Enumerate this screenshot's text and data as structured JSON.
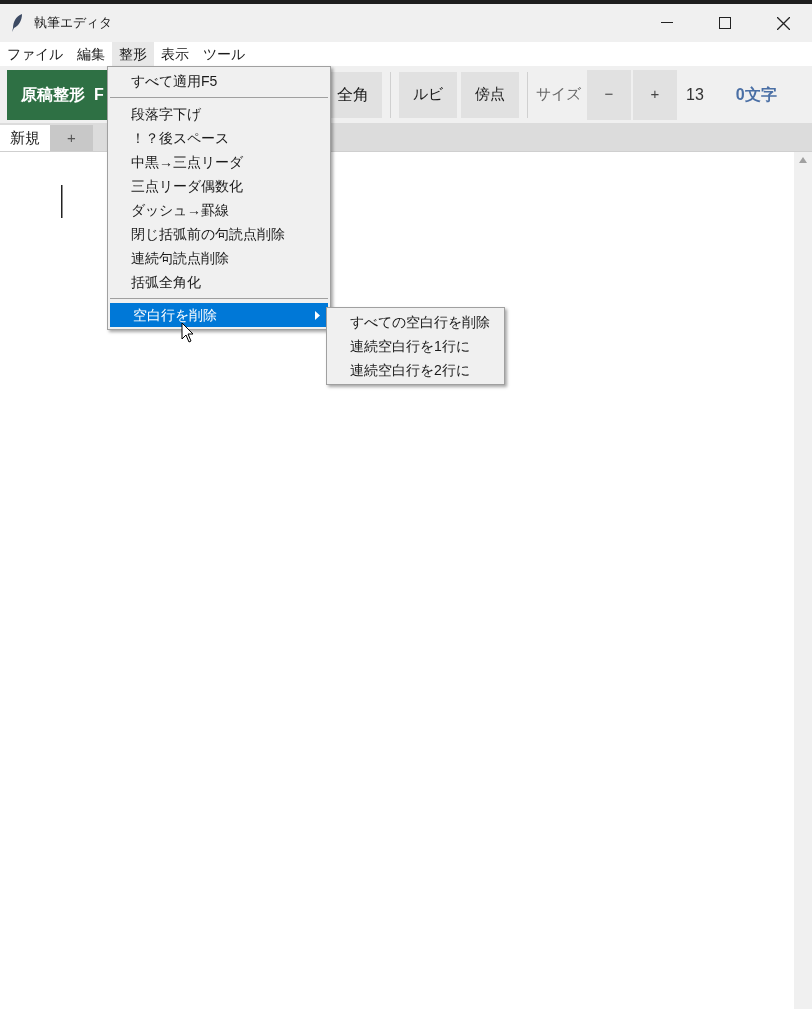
{
  "window": {
    "title": "執筆エディタ"
  },
  "menubar": [
    {
      "label": "ファイル",
      "selected": false
    },
    {
      "label": "編集",
      "selected": false
    },
    {
      "label": "整形",
      "selected": true
    },
    {
      "label": "表示",
      "selected": false
    },
    {
      "label": "ツール",
      "selected": false
    }
  ],
  "toolbar": {
    "format_button": "原稿整形  F",
    "bracket_button": "全角",
    "ruby_button": "ルビ",
    "emphasis_button": "傍点",
    "size_label": "サイズ",
    "decrease": "−",
    "increase": "+",
    "size_value": "13",
    "char_count": "0文字"
  },
  "tabs": [
    {
      "label": "新規",
      "selected": true
    },
    {
      "label": "+",
      "selected": false
    }
  ],
  "menu": {
    "items": [
      {
        "kind": "item",
        "label": "すべて適用F5",
        "selected": false
      },
      {
        "kind": "separator"
      },
      {
        "kind": "item",
        "label": "段落字下げ",
        "selected": false
      },
      {
        "kind": "item",
        "label": "！？後スペース",
        "selected": false
      },
      {
        "kind": "item",
        "label": "中黒→三点リーダ",
        "selected": false
      },
      {
        "kind": "item",
        "label": "三点リーダ偶数化",
        "selected": false
      },
      {
        "kind": "item",
        "label": "ダッシュ→罫線",
        "selected": false
      },
      {
        "kind": "item",
        "label": "閉じ括弧前の句読点削除",
        "selected": false
      },
      {
        "kind": "item",
        "label": "連続句読点削除",
        "selected": false
      },
      {
        "kind": "item",
        "label": "括弧全角化",
        "selected": false
      },
      {
        "kind": "separator"
      },
      {
        "kind": "submenu",
        "label": "空白行を削除",
        "selected": true
      }
    ]
  },
  "submenu": {
    "items": [
      {
        "label": "すべての空白行を削除"
      },
      {
        "label": "連続空白行を1行に"
      },
      {
        "label": "連続空白行を2行に"
      }
    ]
  }
}
